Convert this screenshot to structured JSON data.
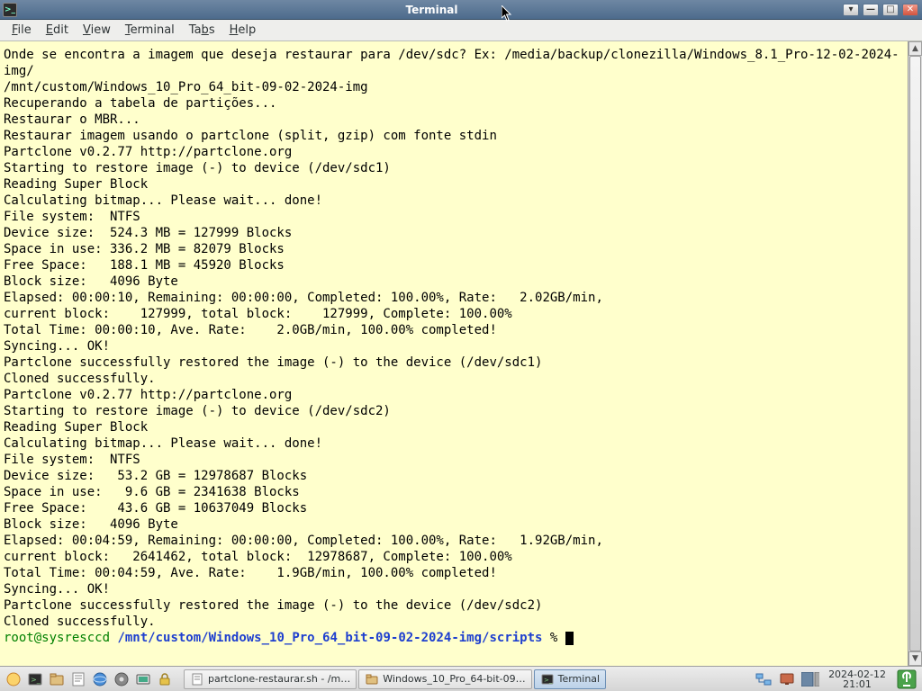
{
  "window": {
    "title": "Terminal"
  },
  "menu": {
    "file": "File",
    "edit": "Edit",
    "view": "View",
    "terminal": "Terminal",
    "tabs": "Tabs",
    "help": "Help"
  },
  "terminal": {
    "lines": [
      "Onde se encontra a imagem que deseja restaurar para /dev/sdc? Ex: /media/backup/clonezilla/Windows_8.1_Pro-12-02-2024-img/",
      "/mnt/custom/Windows_10_Pro_64_bit-09-02-2024-img",
      "Recuperando a tabela de partições...",
      "Restaurar o MBR...",
      "Restaurar imagem usando o partclone (split, gzip) com fonte stdin",
      "Partclone v0.2.77 http://partclone.org",
      "Starting to restore image (-) to device (/dev/sdc1)",
      "Reading Super Block",
      "Calculating bitmap... Please wait... done!",
      "File system:  NTFS",
      "Device size:  524.3 MB = 127999 Blocks",
      "Space in use: 336.2 MB = 82079 Blocks",
      "Free Space:   188.1 MB = 45920 Blocks",
      "Block size:   4096 Byte",
      "Elapsed: 00:00:10, Remaining: 00:00:00, Completed: 100.00%, Rate:   2.02GB/min,",
      "current block:    127999, total block:    127999, Complete: 100.00%",
      "Total Time: 00:00:10, Ave. Rate:    2.0GB/min, 100.00% completed!",
      "Syncing... OK!",
      "Partclone successfully restored the image (-) to the device (/dev/sdc1)",
      "Cloned successfully.",
      "Partclone v0.2.77 http://partclone.org",
      "Starting to restore image (-) to device (/dev/sdc2)",
      "Reading Super Block",
      "Calculating bitmap... Please wait... done!",
      "File system:  NTFS",
      "Device size:   53.2 GB = 12978687 Blocks",
      "Space in use:   9.6 GB = 2341638 Blocks",
      "Free Space:    43.6 GB = 10637049 Blocks",
      "Block size:   4096 Byte",
      "Elapsed: 00:04:59, Remaining: 00:00:00, Completed: 100.00%, Rate:   1.92GB/min,",
      "current block:   2641462, total block:  12978687, Complete: 100.00%",
      "Total Time: 00:04:59, Ave. Rate:    1.9GB/min, 100.00% completed!",
      "Syncing... OK!",
      "Partclone successfully restored the image (-) to the device (/dev/sdc2)",
      "Cloned successfully."
    ],
    "prompt_user_host": "root@sysresccd",
    "prompt_path": "/mnt/custom/Windows_10_Pro_64_bit-09-02-2024-img/scripts",
    "prompt_suffix": " % "
  },
  "tasks": {
    "t1": "partclone-restaurar.sh - /m…",
    "t2": "Windows_10_Pro_64-bit-09…",
    "t3": "Terminal"
  },
  "clock": {
    "date": "2024-02-12",
    "time": "21:01"
  }
}
